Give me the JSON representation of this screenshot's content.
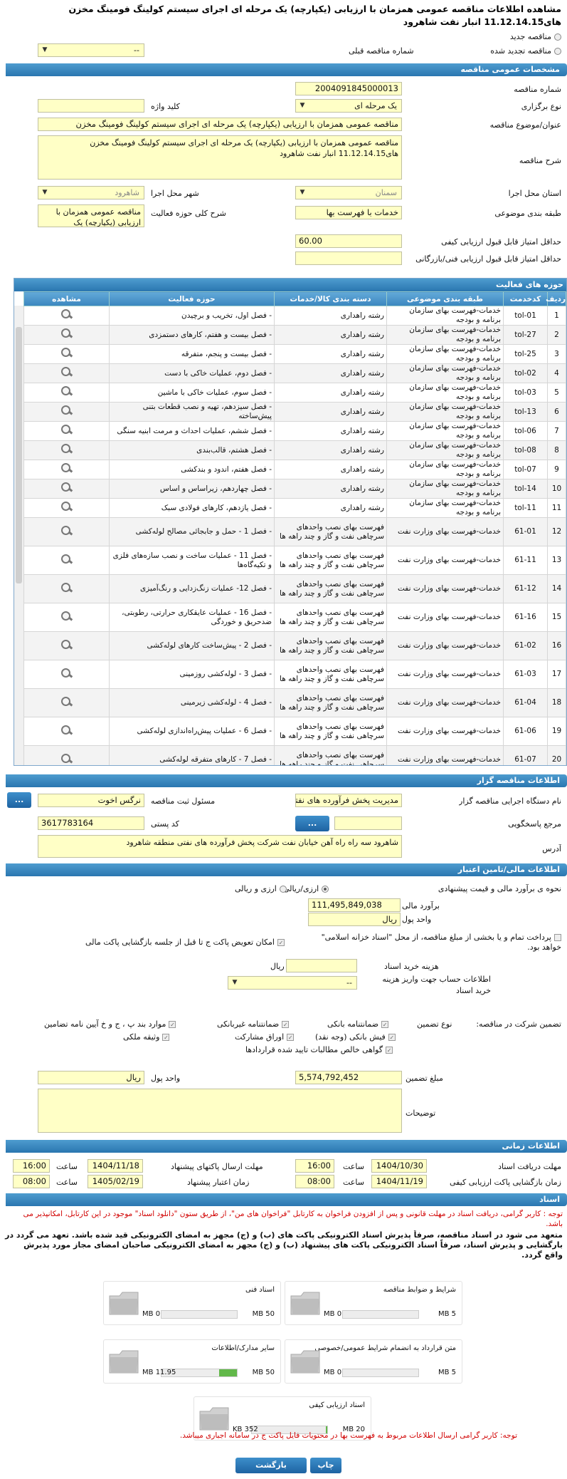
{
  "page_title": "مشاهده اطلاعات مناقصه عمومی همزمان با ارزیابی (یکپارچه) یک مرحله ای اجرای سیستم کولینگ فومینگ مخزن های11.12.14.15 انبار نفت شاهرود",
  "tender_type_options": {
    "new": "مناقصه جدید",
    "renewed": "مناقصه تجدید شده"
  },
  "prev_tender": {
    "label": "شماره مناقصه قبلی",
    "value": "--"
  },
  "sections": {
    "general": "مشخصات عمومی مناقصه",
    "activity": "حوزه های فعالیت",
    "organizer": "اطلاعات مناقصه گزار",
    "financial": "اطلاعات مالی/تامین اعتبار",
    "timing": "اطلاعات زمانی",
    "documents": "اسناد"
  },
  "general": {
    "tender_no_label": "شماره مناقصه",
    "tender_no": "2004091845000013",
    "holding_type_label": "نوع برگزاری",
    "holding_type": "یک مرحله ای",
    "keyword_label": "کلید واژه",
    "subject_label": "عنوان/موضوع مناقصه",
    "subject": "مناقصه عمومی همزمان با ارزیابی (یکپارچه) یک مرحله ای اجرای سیستم کولینگ فومینگ مخزن",
    "desc_label": "شرح مناقصه",
    "desc": "مناقصه عمومی همزمان با ارزیابی (یکپارچه) یک مرحله ای اجرای سیستم کولینگ فومینگ مخزن های11.12.14.15 انبار نفت شاهرود",
    "province_label": "استان محل اجرا",
    "province": "سمنان",
    "city_label": "شهر محل اجرا",
    "city": "شاهرود",
    "category_label": "طبقه بندی موضوعی",
    "category": "خدمات با فهرست بها",
    "activity_desc_label": "شرح کلی حوزه فعالیت",
    "activity_desc": "مناقصه عمومی همزمان با ارزیابی (یکپارچه) یک",
    "min_quality_label": "حداقل امتیاز قابل قبول ارزیابی کیفی",
    "min_quality": "60.00",
    "min_tech_label": "حداقل امتیاز قابل قبول ارزیابی فنی/بازرگانی",
    "min_tech": ""
  },
  "activity_table": {
    "headers": [
      "ردیف",
      "کدخدمت",
      "طبقه بندی موضوعی",
      "دسته بندی کالا/خدمات",
      "حوزه فعالیت",
      "مشاهده"
    ],
    "rows": [
      [
        "1",
        "tol-01",
        "خدمات-فهرست بهای سازمان برنامه و بودجه",
        "رشته راهداری",
        "- فصل اول، تخریب و برچیدن"
      ],
      [
        "2",
        "tol-27",
        "خدمات-فهرست بهای سازمان برنامه و بودجه",
        "رشته راهداری",
        "- فصل بیست و هفتم، کارهای دستمزدی"
      ],
      [
        "3",
        "tol-25",
        "خدمات-فهرست بهای سازمان برنامه و بودجه",
        "رشته راهداری",
        "- فصل بیست و پنجم، متفرقه"
      ],
      [
        "4",
        "tol-02",
        "خدمات-فهرست بهای سازمان برنامه و بودجه",
        "رشته راهداری",
        "- فصل دوم، عملیات خاکی با دست"
      ],
      [
        "5",
        "tol-03",
        "خدمات-فهرست بهای سازمان برنامه و بودجه",
        "رشته راهداری",
        "- فصل سوم، عملیات خاکی با ماشین"
      ],
      [
        "6",
        "tol-13",
        "خدمات-فهرست بهای سازمان برنامه و بودجه",
        "رشته راهداری",
        "- فصل سیزدهم، تهیه و نصب قطعات بتنی پیش‌ساخته"
      ],
      [
        "7",
        "tol-06",
        "خدمات-فهرست بهای سازمان برنامه و بودجه",
        "رشته راهداری",
        "- فصل ششم، عملیات احداث و مرمت ابنیه سنگی"
      ],
      [
        "8",
        "tol-08",
        "خدمات-فهرست بهای سازمان برنامه و بودجه",
        "رشته راهداری",
        "- فصل هشتم، قالب‌بندی"
      ],
      [
        "9",
        "tol-07",
        "خدمات-فهرست بهای سازمان برنامه و بودجه",
        "رشته راهداری",
        "- فصل هفتم، اندود و بندکشی"
      ],
      [
        "10",
        "tol-14",
        "خدمات-فهرست بهای سازمان برنامه و بودجه",
        "رشته راهداری",
        "- فصل چهاردهم، زیراساس و اساس"
      ],
      [
        "11",
        "tol-11",
        "خدمات-فهرست بهای سازمان برنامه و بودجه",
        "رشته راهداری",
        "- فصل یازدهم، کارهای فولادی سبک"
      ],
      [
        "12",
        "61-01",
        "خدمات-فهرست بهای وزارت نفت",
        "فهرست بهای نصب واحدهای سرچاهی نفت و گاز و چند راهه ها",
        "- فصل 1 - حمل و جابجائی مصالح لوله‌کشی"
      ],
      [
        "13",
        "61-11",
        "خدمات-فهرست بهای وزارت نفت",
        "فهرست بهای نصب واحدهای سرچاهی نفت و گاز و چند راهه ها",
        "- فصل 11 - عملیات ساخت و نصب سازه‌های فلزی و تکیه‌گاه‌ها"
      ],
      [
        "14",
        "61-12",
        "خدمات-فهرست بهای وزارت نفت",
        "فهرست بهای نصب واحدهای سرچاهی نفت و گاز و چند راهه ها",
        "- فصل 12- عملیات زنگ‌زدایی و رنگ‌آمیزی"
      ],
      [
        "15",
        "61-16",
        "خدمات-فهرست بهای وزارت نفت",
        "فهرست بهای نصب واحدهای سرچاهی نفت و گاز و چند راهه ها",
        "- فصل 16 - عملیات عایقکاری حرارتی، رطوبتی، ضدحریق و خوردگی"
      ],
      [
        "16",
        "61-02",
        "خدمات-فهرست بهای وزارت نفت",
        "فهرست بهای نصب واحدهای سرچاهی نفت و گاز و چند راهه ها",
        "- فصل 2 - پیش‌ساخت کارهای لوله‌کشی"
      ],
      [
        "17",
        "61-03",
        "خدمات-فهرست بهای وزارت نفت",
        "فهرست بهای نصب واحدهای سرچاهی نفت و گاز و چند راهه ها",
        "- فصل 3 - لوله‌کشی روزمینی"
      ],
      [
        "18",
        "61-04",
        "خدمات-فهرست بهای وزارت نفت",
        "فهرست بهای نصب واحدهای سرچاهی نفت و گاز و چند راهه ها",
        "- فصل 4 - لوله‌کشی زیرمینی"
      ],
      [
        "19",
        "61-06",
        "خدمات-فهرست بهای وزارت نفت",
        "فهرست بهای نصب واحدهای سرچاهی نفت و گاز و چند راهه ها",
        "- فصل 6 - عملیات پیش‌راه‌اندازی لوله‌کشی"
      ],
      [
        "20",
        "61-07",
        "خدمات-فهرست بهای وزارت نفت",
        "فهرست بهای نصب واحدهای سرچاهی نفت و گاز و چند راهه ها",
        "- فصل 7 - کارهای متفرقه لوله‌کشی"
      ]
    ]
  },
  "organizer": {
    "executor_label": "نام دستگاه اجرایی مناقصه گزار",
    "executor": "مدیریت پخش فرآورده های نفتی",
    "registrar_label": "مسئول ثبت مناقصه",
    "registrar": "نرگس اخوت",
    "reference_label": "مرجع پاسخگویی",
    "reference": "",
    "postal_label": "کد پستی",
    "postal": "3617783164",
    "address_label": "آدرس",
    "address": "شاهرود سه راه راه آهن خیابان نفت شرکت  پخش فرآورده های نفتی منطقه شاهرود",
    "more_btn": "...",
    "dots_btn": "..."
  },
  "financial": {
    "estimate_type_label": "نحوه ی برآورد مالی و قیمت پیشنهادی",
    "opt_rial": "ارزی/ریالی",
    "opt_currency": "ارزی و ریالی",
    "estimate_label": "برآورد مالی",
    "estimate": "111,495,849,038",
    "unit_label": "واحد پول",
    "unit": "ریال",
    "treasury_text": "پرداخت تمام و یا بخشی از مبلغ مناقصه، از محل \"اسناد خزانه اسلامی\"",
    "treasury_sub": "خواهد بود.",
    "replace_text": "امکان تعویض پاکت ج تا قبل از جلسه بازگشایی پاکت مالی",
    "doc_cost_label": "هزینه خرید اسناد",
    "doc_cost": "",
    "doc_cost_unit": "ریال",
    "account_label": "اطلاعات حساب جهت واریز هزینه خرید اسناد",
    "account_value": "--",
    "part_label": "تضمین شرکت در مناقصه:",
    "guarantee_type_label": "نوع تضمین",
    "g_bank": "ضمانتنامه بانکی",
    "g_nonbank": "ضمانتنامه غیربانکی",
    "g_cases": "موارد بند پ ، ج و خ آیین نامه تضامین",
    "g_check": "فیش بانکی (وجه نقد)",
    "g_bonds": "اوراق مشارکت",
    "g_property": "وثیقه ملکی",
    "g_cert": "گواهی خالص مطالبات تایید شده قراردادها",
    "guarantee_amount_label": "مبلغ تضمین",
    "guarantee_amount": "5,574,792,452",
    "guarantee_unit_label": "واحد پول",
    "guarantee_unit": "ریال",
    "notes_label": "توضیحات",
    "notes": ""
  },
  "timing": {
    "doc_deadline_label": "مهلت دریافت اسناد",
    "doc_deadline_date": "1404/10/30",
    "doc_deadline_time": "16:00",
    "send_deadline_label": "مهلت ارسال پاکتهای پیشنهاد",
    "send_deadline_date": "1404/11/18",
    "send_deadline_time": "16:00",
    "quality_open_label": "زمان بازگشایی پاکت ارزیابی کیفی",
    "quality_open_date": "1404/11/19",
    "quality_open_time": "08:00",
    "validity_label": "زمان اعتبار پیشنهاد",
    "validity_date": "1405/02/19",
    "validity_time": "08:00",
    "time_label": "ساعت"
  },
  "documents": {
    "notice1": "توجه : کاربر گرامی، دریافت اسناد در مهلت قانونی و پس از افزودن فراخوان به کارتابل \"فراخوان های من\"، از طریق ستون \"دانلود اسناد\" موجود در این کارتابل، امکانپذیر می باشد.",
    "commit": "متعهد می شود در اسناد مناقصه، صرفاً پذیرش اسناد الکترونیکی پاکت های (ب) و (ج) مجهز به امضای الکترونیکی قید شده باشد. تعهد می گردد در بارگشایی و پذیرش اسناد، صرفاً اسناد الکترونیکی پاکت های پیشنهاد (ب) و (ج) مجهز به امضای الکترونیکی صاحبان امضای مجاز مورد پذیرش واقع گردد.",
    "items": [
      {
        "title": "شرایط و ضوابط مناقصه",
        "max": "5 MB",
        "current": "0 MB",
        "fill": 0
      },
      {
        "title": "اسناد فنی",
        "max": "50 MB",
        "current": "0 MB",
        "fill": 0
      },
      {
        "title": "متن قرارداد به انضمام شرایط عمومی/خصوصی",
        "max": "5 MB",
        "current": "0 MB",
        "fill": 0
      },
      {
        "title": "سایر مدارک/اطلاعات",
        "max": "50 MB",
        "current": "11.95 MB",
        "fill": 0.24
      },
      {
        "title": "اسناد ارزیابی کیفی",
        "max": "20 MB",
        "current": "352 KB",
        "fill": 0.02
      }
    ],
    "notice2": "توجه:  کاربر گرامی ارسال اطلاعات مربوط به فهرست بها در محتویات فایل پاکت ج در سامانه اجباری میباشد."
  },
  "footer": {
    "print": "چاپ",
    "back": "بازگشت"
  },
  "colors": {
    "header_blue": "#2a76b0",
    "field_yellow": "#ffffc6",
    "warn_red": "#d10000",
    "progress_green": "#62b84a"
  }
}
